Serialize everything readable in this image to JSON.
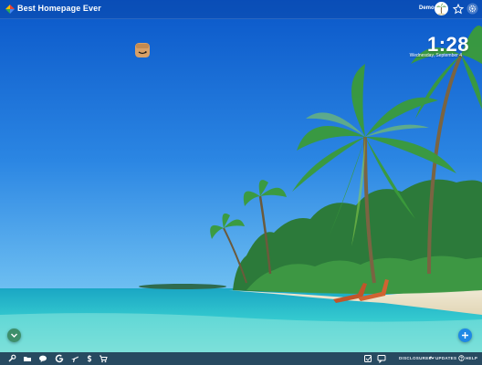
{
  "header": {
    "brand": "Best Homepage Ever",
    "user_name": "Demo",
    "icons": [
      "logo-icon",
      "avatar-palm-icon",
      "star-icon",
      "gear-icon"
    ]
  },
  "clock": {
    "time": "1:28",
    "date": "Wednesday, September 4"
  },
  "shortcuts": [
    {
      "name": "amazon",
      "icon": "amazon-box-icon"
    }
  ],
  "fabs": {
    "left_icon": "chevron-down-icon",
    "right_icon": "plus-icon"
  },
  "bottom_bar": {
    "left_icons": [
      "wrench-icon",
      "folder-icon",
      "chat-icon",
      "google-icon",
      "flight-icon",
      "dollar-icon",
      "cart-icon"
    ],
    "right_icons": [
      "note-icon",
      "message-icon"
    ],
    "labels": {
      "disclosures": "DISCLOSURES",
      "updates": "UPDATES",
      "help": "HELP"
    }
  },
  "colors": {
    "sky_top": "#0a57c9",
    "sky_bottom": "#4aa8ef",
    "sea": "#2fc4cf",
    "fab_left": "#3d8f6a",
    "fab_right": "#1e88e5"
  }
}
